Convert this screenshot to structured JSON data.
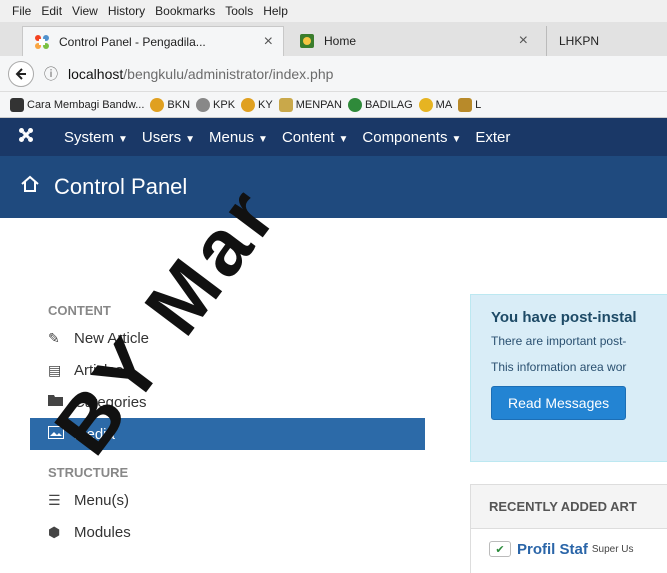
{
  "menubar": [
    "File",
    "Edit",
    "View",
    "History",
    "Bookmarks",
    "Tools",
    "Help"
  ],
  "tabs": [
    {
      "title": "Control Panel - Pengadila...",
      "close": "×"
    },
    {
      "title": "Home",
      "close": "×"
    },
    {
      "title": "LHKPN"
    }
  ],
  "url": {
    "host": "localhost",
    "path": "/bengkulu/administrator/index.php"
  },
  "bookmarks": [
    "Cara Membagi Bandw...",
    "BKN",
    "KPK",
    "KY",
    "MENPAN",
    "BADILAG",
    "MA",
    "L"
  ],
  "jnav": {
    "items": [
      "System",
      "Users",
      "Menus",
      "Content",
      "Components",
      "Exter"
    ]
  },
  "header": {
    "title": "Control Panel"
  },
  "sidebar": {
    "content_heading": "CONTENT",
    "content_items": [
      "New Article",
      "Articles",
      "Categories",
      "Media"
    ],
    "structure_heading": "STRUCTURE",
    "structure_items": [
      "Menu(s)",
      "Modules"
    ]
  },
  "alert": {
    "title": "You have post-instal",
    "line1": "There are important post-",
    "line2": "This information area wor",
    "button": "Read Messages"
  },
  "recent": {
    "heading": "RECENTLY ADDED ART",
    "row_title": "Profil Staf",
    "row_author": "Super Us"
  },
  "watermark": "BY Mar"
}
